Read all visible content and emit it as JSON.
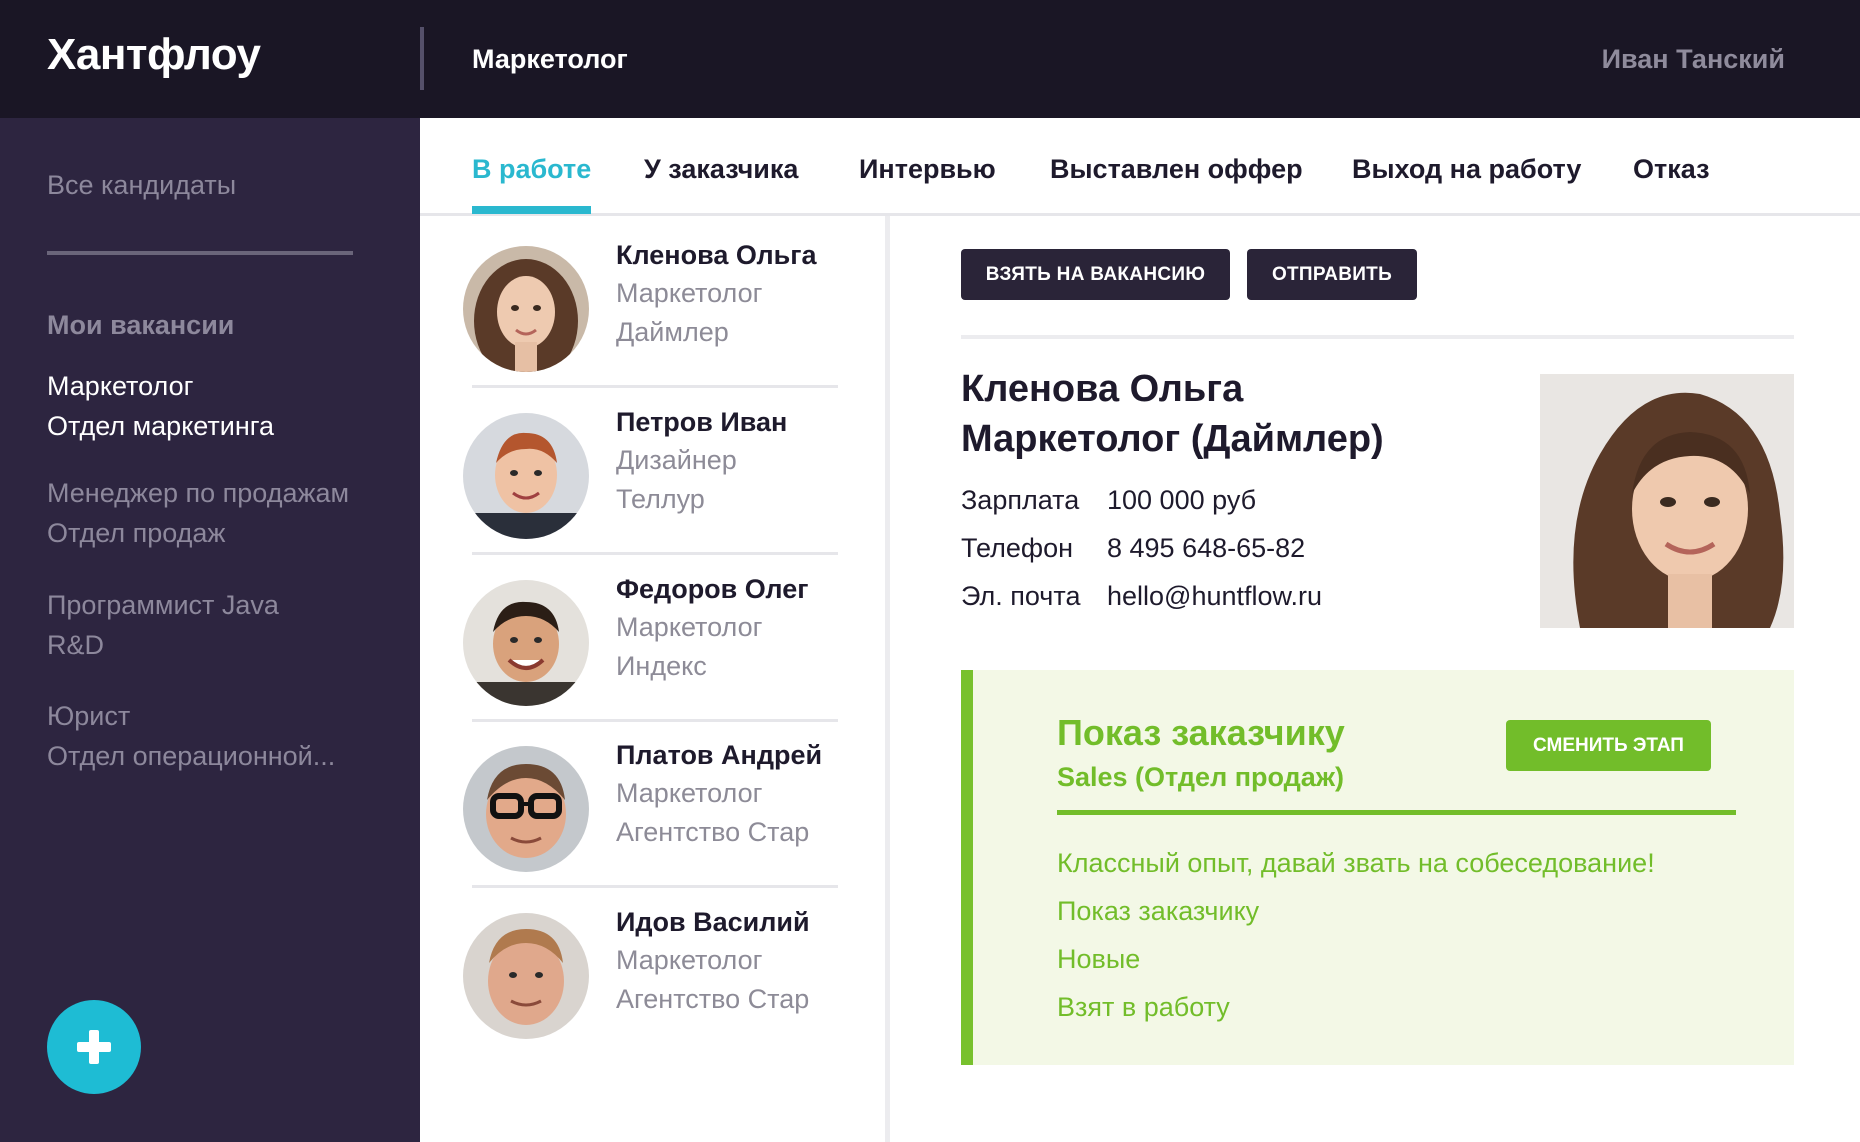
{
  "header": {
    "logo": "Хантфлоу",
    "vacancy_title": "Маркетолог",
    "user_name": "Иван Танский"
  },
  "sidebar": {
    "all_candidates": "Все кандидаты",
    "my_vacancies_heading": "Мои вакансии",
    "vacancies": [
      {
        "title": "Маркетолог",
        "department": "Отдел маркетинга",
        "active": true
      },
      {
        "title": "Менеджер по продажам",
        "department": "Отдел продаж",
        "active": false
      },
      {
        "title": "Программист Java",
        "department": "R&D",
        "active": false
      },
      {
        "title": "Юрист",
        "department": "Отдел операционной...",
        "active": false
      }
    ],
    "add_button_icon": "plus-icon"
  },
  "tabs": [
    {
      "label": "В работе",
      "active": true
    },
    {
      "label": "У заказчика",
      "active": false
    },
    {
      "label": "Интервью",
      "active": false
    },
    {
      "label": "Выставлен оффер",
      "active": false
    },
    {
      "label": "Выход на работу",
      "active": false
    },
    {
      "label": "Отказ",
      "active": false
    }
  ],
  "candidates": [
    {
      "name": "Кленова Ольга",
      "role": "Маркетолог",
      "company": "Даймлер"
    },
    {
      "name": "Петров Иван",
      "role": "Дизайнер",
      "company": "Теллур"
    },
    {
      "name": "Федоров Олег",
      "role": "Маркетолог",
      "company": "Индекс"
    },
    {
      "name": "Платов Андрей",
      "role": "Маркетолог",
      "company": "Агентство Стар"
    },
    {
      "name": "Идов Василий",
      "role": "Маркетолог",
      "company": "Агентство Стар"
    }
  ],
  "detail": {
    "take_button": "ВЗЯТЬ НА ВАКАНСИЮ",
    "send_button": "ОТПРАВИТЬ",
    "name": "Кленова Ольга",
    "position": "Маркетолог (Даймлер)",
    "fields": [
      {
        "label": "Зарплата",
        "value": "100 000 руб"
      },
      {
        "label": "Телефон",
        "value": "8 495 648-65-82"
      },
      {
        "label": "Эл. почта",
        "value": "hello@huntflow.ru"
      }
    ],
    "stage": {
      "title": "Показ заказчику",
      "subtitle": "Sales (Отдел продаж)",
      "change_button": "СМЕНИТЬ ЭТАП",
      "history": [
        "Классный опыт, давай звать на собеседование!",
        "Показ заказчику",
        "Новые",
        "Взят в работу"
      ]
    }
  },
  "colors": {
    "header_bg": "#1a1625",
    "sidebar_bg": "#2d2540",
    "accent_cyan": "#2ab8cf",
    "accent_green": "#72bd2a",
    "stage_bg": "#f3f8e6"
  }
}
